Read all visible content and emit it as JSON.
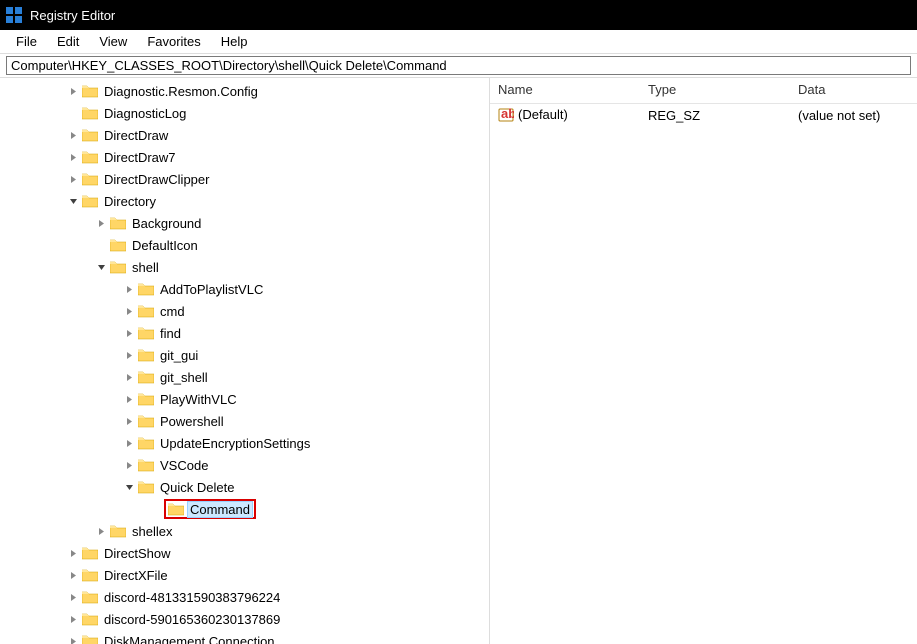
{
  "window": {
    "title": "Registry Editor"
  },
  "menu": {
    "file": "File",
    "edit": "Edit",
    "view": "View",
    "favorites": "Favorites",
    "help": "Help"
  },
  "address": {
    "path": "Computer\\HKEY_CLASSES_ROOT\\Directory\\shell\\Quick Delete\\Command"
  },
  "tree": {
    "items": [
      {
        "label": "Diagnostic.Resmon.Config",
        "level": 2,
        "expander": "closed"
      },
      {
        "label": "DiagnosticLog",
        "level": 2,
        "expander": "none"
      },
      {
        "label": "DirectDraw",
        "level": 2,
        "expander": "closed"
      },
      {
        "label": "DirectDraw7",
        "level": 2,
        "expander": "closed"
      },
      {
        "label": "DirectDrawClipper",
        "level": 2,
        "expander": "closed"
      },
      {
        "label": "Directory",
        "level": 2,
        "expander": "open"
      },
      {
        "label": "Background",
        "level": 3,
        "expander": "closed"
      },
      {
        "label": "DefaultIcon",
        "level": 3,
        "expander": "none"
      },
      {
        "label": "shell",
        "level": 3,
        "expander": "open"
      },
      {
        "label": "AddToPlaylistVLC",
        "level": 4,
        "expander": "closed"
      },
      {
        "label": "cmd",
        "level": 4,
        "expander": "closed"
      },
      {
        "label": "find",
        "level": 4,
        "expander": "closed"
      },
      {
        "label": "git_gui",
        "level": 4,
        "expander": "closed"
      },
      {
        "label": "git_shell",
        "level": 4,
        "expander": "closed"
      },
      {
        "label": "PlayWithVLC",
        "level": 4,
        "expander": "closed"
      },
      {
        "label": "Powershell",
        "level": 4,
        "expander": "closed"
      },
      {
        "label": "UpdateEncryptionSettings",
        "level": 4,
        "expander": "closed"
      },
      {
        "label": "VSCode",
        "level": 4,
        "expander": "closed"
      },
      {
        "label": "Quick Delete",
        "level": 4,
        "expander": "open"
      },
      {
        "label": "Command",
        "level": 5,
        "expander": "none",
        "selected": true,
        "highlight": true
      },
      {
        "label": "shellex",
        "level": 3,
        "expander": "closed"
      },
      {
        "label": "DirectShow",
        "level": 2,
        "expander": "closed"
      },
      {
        "label": "DirectXFile",
        "level": 2,
        "expander": "closed"
      },
      {
        "label": "discord-481331590383796224",
        "level": 2,
        "expander": "closed"
      },
      {
        "label": "discord-590165360230137869",
        "level": 2,
        "expander": "closed"
      },
      {
        "label": "DiskManagement.Connection",
        "level": 2,
        "expander": "closed"
      }
    ]
  },
  "list": {
    "columns": {
      "name": "Name",
      "type": "Type",
      "data": "Data"
    },
    "rows": [
      {
        "name": "(Default)",
        "type": "REG_SZ",
        "data": "(value not set)"
      }
    ]
  }
}
